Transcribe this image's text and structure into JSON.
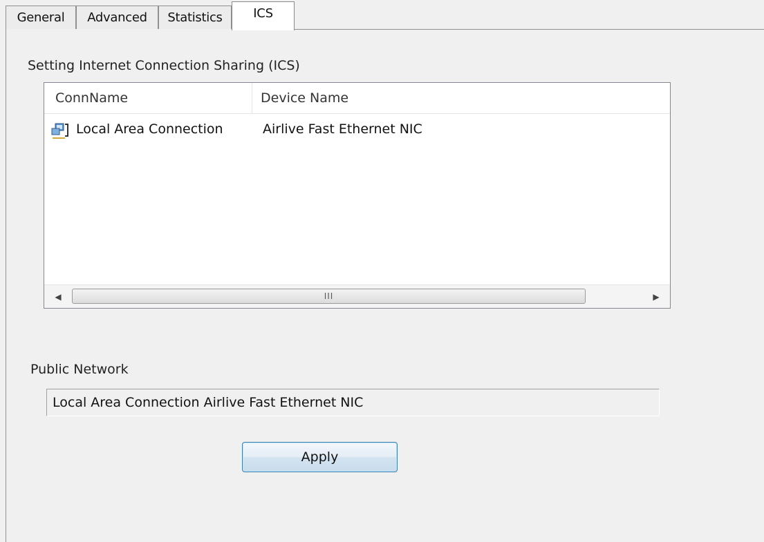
{
  "tabs": [
    {
      "label": "General"
    },
    {
      "label": "Advanced"
    },
    {
      "label": "Statistics"
    },
    {
      "label": "ICS"
    }
  ],
  "active_tab": "ICS",
  "ics": {
    "section_title": "Setting Internet Connection Sharing (ICS)",
    "columns": [
      "ConnName",
      "Device Name"
    ],
    "rows": [
      {
        "conn_name": "Local Area Connection",
        "device_name": "Airlive Fast Ethernet NIC",
        "icon": "network-connection-icon"
      }
    ],
    "scrollbar_grip": "III"
  },
  "public_network": {
    "label": "Public Network",
    "value": "Local Area Connection Airlive Fast Ethernet NIC"
  },
  "apply_label": "Apply",
  "colors": {
    "button_border": "#3c7fb1",
    "panel_background": "#f0f0f0"
  }
}
